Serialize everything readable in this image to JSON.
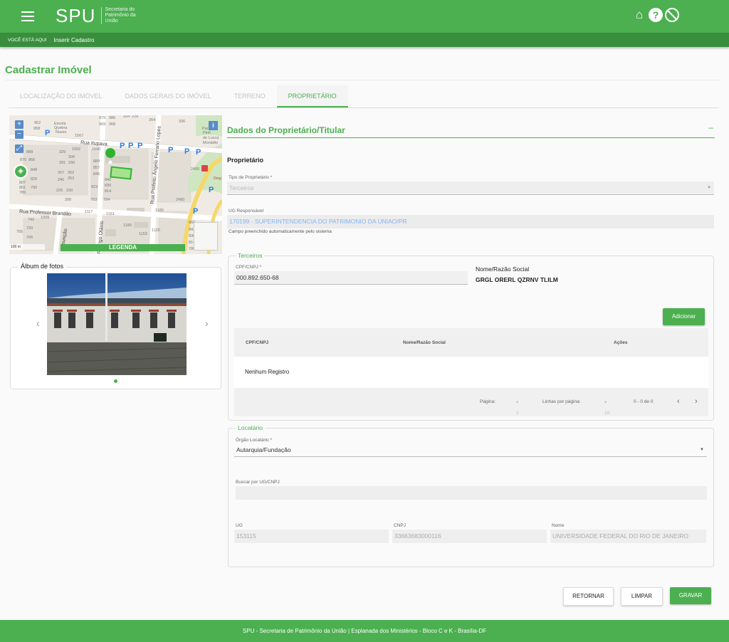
{
  "header": {
    "logo": "SPU",
    "logo_subtitle": "Secretaria do Patrimônio da União",
    "icons": [
      "home-icon",
      "help-icon",
      "block-icon"
    ]
  },
  "breadcrumb": {
    "here_label": "VOCÊ ESTÁ AQUI",
    "current": "Inserir Cadastro"
  },
  "page": {
    "title": "Cadastrar Imóvel"
  },
  "tabs": [
    {
      "label": "LOCALIZAÇÃO DO IMÓVEL",
      "active": false
    },
    {
      "label": "DADOS GERAIS DO IMÓVEL",
      "active": false
    },
    {
      "label": "TERRENO",
      "active": false
    },
    {
      "label": "PROPRIETÁRIO",
      "active": true
    }
  ],
  "map": {
    "legend_label": "LEGENDA",
    "info_label": "i",
    "streets": [
      "Rua Itupava",
      "Rua Professor Brandão",
      "Rua Prefeito Ângelo Ferrario Lopes",
      "Rodrigo Otávio",
      "Assunção"
    ],
    "scale": "100 m"
  },
  "album": {
    "title": "Álbum de fotos"
  },
  "owner_section": {
    "title": "Dados do Proprietário/Titular",
    "collapse": "–",
    "subtitle": "Proprietário",
    "tipo_label": "Tipo de Proprietário *",
    "tipo_value": "Terceiros",
    "ug_label": "UG Responsável",
    "ug_value": "170199 - SUPERINTENDENCIA DO PATRIMONIO DA UNIAO/PR",
    "ug_hint": "Campo preenchido automaticamente pelo sistema"
  },
  "terceiros": {
    "legend": "Terceiros",
    "cpf_label": "CPF/CNPJ *",
    "cpf_value": "000.892.650-68",
    "nome_label": "Nome/Razão Social",
    "nome_value": "GRGL ORERL QZRNV TLILM",
    "add_button": "Adicionar",
    "table": {
      "headers": [
        "CPF/CNPJ",
        "Nome/Razão Social",
        "Ações"
      ],
      "empty": "Nenhum Registro",
      "page_label": "Página:",
      "page_value": "1",
      "rows_label": "Linhas por página:",
      "rows_value": "10",
      "range": "0 - 0 de 0"
    }
  },
  "locatario": {
    "legend": "Locatário",
    "orgao_label": "Órgão Locatário *",
    "orgao_value": "Autarquia/Fundação",
    "buscar_label": "Buscar por UG/CNPJ",
    "ug_label": "UG",
    "ug_value": "153115",
    "cnpj_label": "CNPJ",
    "cnpj_value": "33663683000116",
    "nome_label": "Nome",
    "nome_value": "UNIVERSIDADE FEDERAL DO RIO DE JANEIRO"
  },
  "actions": {
    "retornar": "RETORNAR",
    "limpar": "LIMPAR",
    "gravar": "GRAVAR"
  },
  "footer": {
    "text": "SPU - Secretaria de Patrimônio da União | Esplanada dos Ministérios - Bloco C e K - Brasília-DF"
  },
  "colors": {
    "primary": "#4caf50",
    "primary_dark": "#388e3c",
    "link_blue": "#7fb3f7"
  }
}
